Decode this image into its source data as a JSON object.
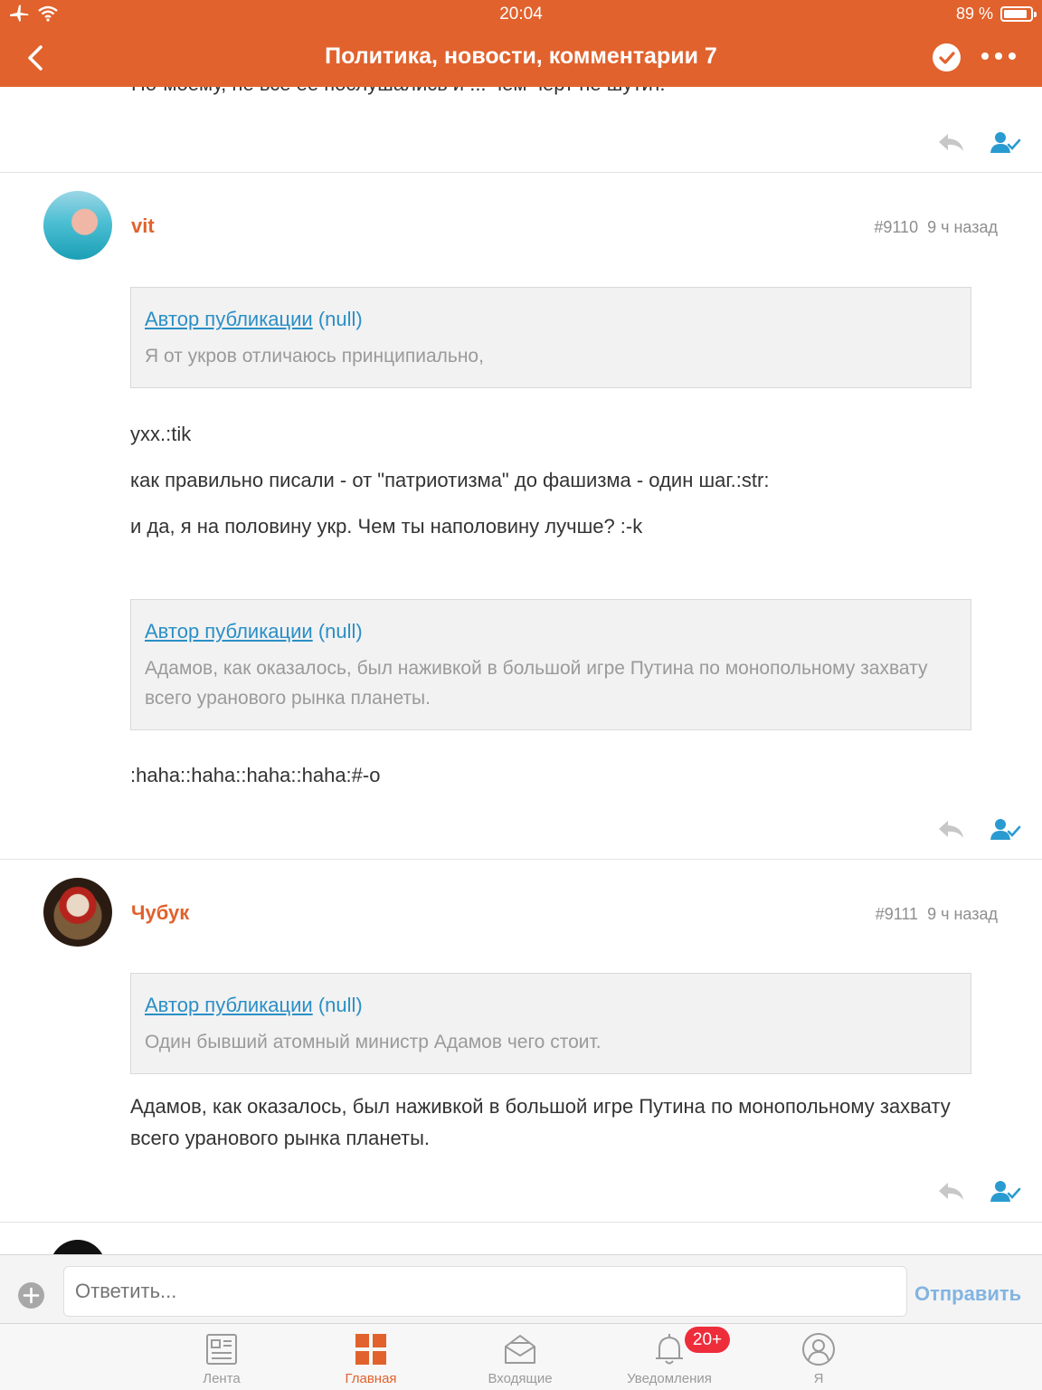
{
  "status_bar": {
    "time": "20:04",
    "battery": "89 %",
    "battery_level": 0.89
  },
  "nav": {
    "title": "Политика, новости, комментарии 7",
    "icons": [
      "chevron-left-icon",
      "check-circle-icon",
      "more-icon"
    ]
  },
  "previous_comment": {
    "cut_text": "По-моему, не все ее послушались и ... чем черт не шутит."
  },
  "comments": [
    {
      "author": "vit",
      "number": "#9110",
      "time": "9 ч назад",
      "quotes": [
        {
          "author_link": "Автор публикации",
          "author_suffix": "(null)",
          "text": "Я от укров отличаюсь принципиально,"
        },
        {
          "author_link": "Автор публикации",
          "author_suffix": "(null)",
          "text": "Адамов, как оказалось, был наживкой в большой  игре Путина по монопольному захвату всего уранового рынка  планеты."
        }
      ],
      "lines": [
        "yxx.:tik",
        "как правильно писали - от \"патриотизма\" до фашизма - один шаг.:str:",
        "и да, я на половину укр. Чем ты наполовину лучше? :-k",
        ":haha::haha::haha::haha:#-o"
      ]
    },
    {
      "author": "Чубук",
      "number": "#9111",
      "time": "9 ч назад",
      "quotes": [
        {
          "author_link": "Автор публикации",
          "author_suffix": "(null)",
          "text": "Один бывший атомный министр Адамов чего стоит."
        }
      ],
      "lines": [
        "Адамов, как оказалось, был наживкой в большой игре Путина по монопольному захвату всего уранового рынка планеты."
      ]
    }
  ],
  "reply": {
    "placeholder": "Ответить...",
    "send_label": "Отправить"
  },
  "tabs": [
    {
      "label": "Лента",
      "icon": "feed-icon",
      "active": false
    },
    {
      "label": "Главная",
      "icon": "home-grid-icon",
      "active": true
    },
    {
      "label": "Входящие",
      "icon": "inbox-icon",
      "active": false
    },
    {
      "label": "Уведомления",
      "icon": "bell-icon",
      "active": false,
      "badge": "20+"
    },
    {
      "label": "Я",
      "icon": "profile-icon",
      "active": false
    }
  ],
  "colors": {
    "accent": "#e1622d",
    "link": "#2a8fc6",
    "action_icon": "#2a9bd0",
    "badge": "#ee2d3b"
  }
}
